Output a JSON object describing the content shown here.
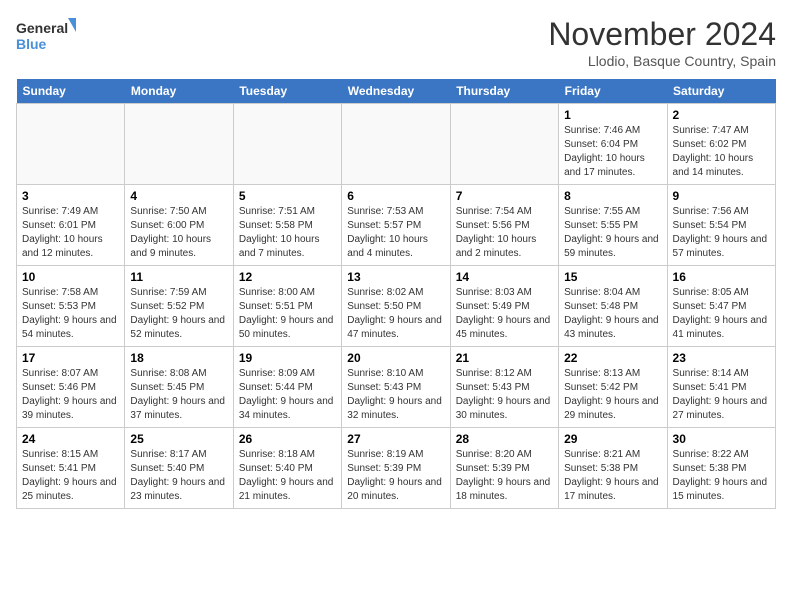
{
  "logo": {
    "line1": "General",
    "line2": "Blue"
  },
  "title": "November 2024",
  "subtitle": "Llodio, Basque Country, Spain",
  "days_of_week": [
    "Sunday",
    "Monday",
    "Tuesday",
    "Wednesday",
    "Thursday",
    "Friday",
    "Saturday"
  ],
  "weeks": [
    [
      {
        "day": "",
        "info": ""
      },
      {
        "day": "",
        "info": ""
      },
      {
        "day": "",
        "info": ""
      },
      {
        "day": "",
        "info": ""
      },
      {
        "day": "",
        "info": ""
      },
      {
        "day": "1",
        "info": "Sunrise: 7:46 AM\nSunset: 6:04 PM\nDaylight: 10 hours and 17 minutes."
      },
      {
        "day": "2",
        "info": "Sunrise: 7:47 AM\nSunset: 6:02 PM\nDaylight: 10 hours and 14 minutes."
      }
    ],
    [
      {
        "day": "3",
        "info": "Sunrise: 7:49 AM\nSunset: 6:01 PM\nDaylight: 10 hours and 12 minutes."
      },
      {
        "day": "4",
        "info": "Sunrise: 7:50 AM\nSunset: 6:00 PM\nDaylight: 10 hours and 9 minutes."
      },
      {
        "day": "5",
        "info": "Sunrise: 7:51 AM\nSunset: 5:58 PM\nDaylight: 10 hours and 7 minutes."
      },
      {
        "day": "6",
        "info": "Sunrise: 7:53 AM\nSunset: 5:57 PM\nDaylight: 10 hours and 4 minutes."
      },
      {
        "day": "7",
        "info": "Sunrise: 7:54 AM\nSunset: 5:56 PM\nDaylight: 10 hours and 2 minutes."
      },
      {
        "day": "8",
        "info": "Sunrise: 7:55 AM\nSunset: 5:55 PM\nDaylight: 9 hours and 59 minutes."
      },
      {
        "day": "9",
        "info": "Sunrise: 7:56 AM\nSunset: 5:54 PM\nDaylight: 9 hours and 57 minutes."
      }
    ],
    [
      {
        "day": "10",
        "info": "Sunrise: 7:58 AM\nSunset: 5:53 PM\nDaylight: 9 hours and 54 minutes."
      },
      {
        "day": "11",
        "info": "Sunrise: 7:59 AM\nSunset: 5:52 PM\nDaylight: 9 hours and 52 minutes."
      },
      {
        "day": "12",
        "info": "Sunrise: 8:00 AM\nSunset: 5:51 PM\nDaylight: 9 hours and 50 minutes."
      },
      {
        "day": "13",
        "info": "Sunrise: 8:02 AM\nSunset: 5:50 PM\nDaylight: 9 hours and 47 minutes."
      },
      {
        "day": "14",
        "info": "Sunrise: 8:03 AM\nSunset: 5:49 PM\nDaylight: 9 hours and 45 minutes."
      },
      {
        "day": "15",
        "info": "Sunrise: 8:04 AM\nSunset: 5:48 PM\nDaylight: 9 hours and 43 minutes."
      },
      {
        "day": "16",
        "info": "Sunrise: 8:05 AM\nSunset: 5:47 PM\nDaylight: 9 hours and 41 minutes."
      }
    ],
    [
      {
        "day": "17",
        "info": "Sunrise: 8:07 AM\nSunset: 5:46 PM\nDaylight: 9 hours and 39 minutes."
      },
      {
        "day": "18",
        "info": "Sunrise: 8:08 AM\nSunset: 5:45 PM\nDaylight: 9 hours and 37 minutes."
      },
      {
        "day": "19",
        "info": "Sunrise: 8:09 AM\nSunset: 5:44 PM\nDaylight: 9 hours and 34 minutes."
      },
      {
        "day": "20",
        "info": "Sunrise: 8:10 AM\nSunset: 5:43 PM\nDaylight: 9 hours and 32 minutes."
      },
      {
        "day": "21",
        "info": "Sunrise: 8:12 AM\nSunset: 5:43 PM\nDaylight: 9 hours and 30 minutes."
      },
      {
        "day": "22",
        "info": "Sunrise: 8:13 AM\nSunset: 5:42 PM\nDaylight: 9 hours and 29 minutes."
      },
      {
        "day": "23",
        "info": "Sunrise: 8:14 AM\nSunset: 5:41 PM\nDaylight: 9 hours and 27 minutes."
      }
    ],
    [
      {
        "day": "24",
        "info": "Sunrise: 8:15 AM\nSunset: 5:41 PM\nDaylight: 9 hours and 25 minutes."
      },
      {
        "day": "25",
        "info": "Sunrise: 8:17 AM\nSunset: 5:40 PM\nDaylight: 9 hours and 23 minutes."
      },
      {
        "day": "26",
        "info": "Sunrise: 8:18 AM\nSunset: 5:40 PM\nDaylight: 9 hours and 21 minutes."
      },
      {
        "day": "27",
        "info": "Sunrise: 8:19 AM\nSunset: 5:39 PM\nDaylight: 9 hours and 20 minutes."
      },
      {
        "day": "28",
        "info": "Sunrise: 8:20 AM\nSunset: 5:39 PM\nDaylight: 9 hours and 18 minutes."
      },
      {
        "day": "29",
        "info": "Sunrise: 8:21 AM\nSunset: 5:38 PM\nDaylight: 9 hours and 17 minutes."
      },
      {
        "day": "30",
        "info": "Sunrise: 8:22 AM\nSunset: 5:38 PM\nDaylight: 9 hours and 15 minutes."
      }
    ]
  ]
}
